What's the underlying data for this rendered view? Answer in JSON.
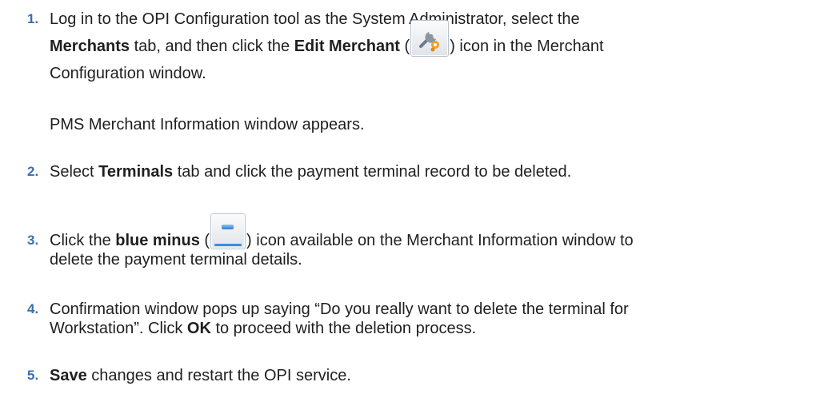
{
  "steps": [
    {
      "number": "1.",
      "line1": "Log in to the OPI Configuration tool as the System Administrator, select the",
      "line2_bold1": "Merchants",
      "line2_text1": " tab, and then click the ",
      "line2_bold2": "Edit Merchant",
      "line2_text2": " (",
      "icon": "wrench-gear-icon",
      "line2_text3": ") icon in the Merchant",
      "line3": "Configuration window.",
      "result": "PMS Merchant Information window appears."
    },
    {
      "number": "2.",
      "text1": "Select ",
      "bold1": "Terminals",
      "text2": " tab and click the payment terminal record to be deleted."
    },
    {
      "number": "3.",
      "text1": "Click the ",
      "bold1": "blue minus",
      "text2": " (",
      "icon": "blue-minus-icon",
      "text3": ") icon available on the Merchant Information window to",
      "line2": "delete the payment terminal details."
    },
    {
      "number": "4.",
      "line1": "Confirmation window pops up saying “Do you really want to delete the terminal for",
      "line2_text1": "Workstation”. Click ",
      "line2_bold1": "OK",
      "line2_text2": " to proceed with the deletion process."
    },
    {
      "number": "5.",
      "bold1": "Save",
      "text1": " changes and restart the OPI service."
    }
  ]
}
